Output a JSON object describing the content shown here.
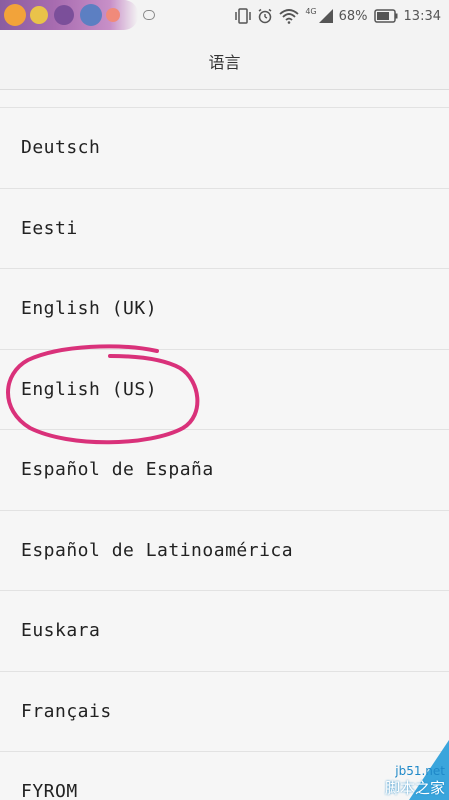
{
  "status_bar": {
    "network": "4G",
    "battery": "68%",
    "time": "13:34"
  },
  "header": {
    "title": "语言"
  },
  "languages": [
    "Deutsch",
    "Eesti",
    "English (UK)",
    "English (US)",
    "Español de España",
    "Español de Latinoamérica",
    "Euskara",
    "Français",
    "FYROM"
  ],
  "annotation": {
    "circled_item": "English (US)",
    "color": "#d9317a"
  },
  "watermark": {
    "site": "jb51.net",
    "name": "脚本之家"
  }
}
